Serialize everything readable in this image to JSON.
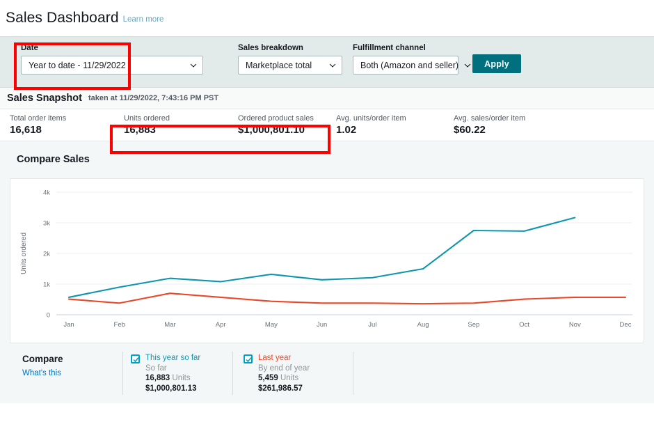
{
  "header": {
    "title": "Sales Dashboard",
    "learn_more": "Learn more"
  },
  "filters": {
    "date": {
      "label": "Date",
      "value": "Year to date - 11/29/2022"
    },
    "sales_breakdown": {
      "label": "Sales breakdown",
      "value": "Marketplace total"
    },
    "fulfillment_channel": {
      "label": "Fulfillment channel",
      "value": "Both (Amazon and seller)"
    },
    "apply_label": "Apply"
  },
  "snapshot": {
    "title": "Sales Snapshot",
    "taken_at": "taken at 11/29/2022, 7:43:16 PM PST",
    "metrics": [
      {
        "label": "Total order items",
        "value": "16,618"
      },
      {
        "label": "Units ordered",
        "value": "16,883"
      },
      {
        "label": "Ordered product sales",
        "value": "$1,000,801.10"
      },
      {
        "label": "Avg. units/order item",
        "value": "1.02"
      },
      {
        "label": "Avg. sales/order item",
        "value": "$60.22"
      }
    ]
  },
  "compare": {
    "heading": "Compare Sales",
    "compare_label": "Compare",
    "whats_this": "What's this",
    "series": [
      {
        "name": "This year so far",
        "period": "So far",
        "units_value": "16,883",
        "units_word": "Units",
        "amount": "$1,000,801.13",
        "color": "#0e96ae",
        "checked": true
      },
      {
        "name": "Last year",
        "period": "By end of year",
        "units_value": "5,459",
        "units_word": "Units",
        "amount": "$261,986.57",
        "color": "#e8492b",
        "checked": true
      }
    ]
  },
  "chart_data": {
    "type": "line",
    "title": "Compare Sales",
    "xlabel": "",
    "ylabel": "Units ordered",
    "categories": [
      "Jan",
      "Feb",
      "Mar",
      "Apr",
      "May",
      "Jun",
      "Jul",
      "Aug",
      "Sep",
      "Oct",
      "Nov",
      "Dec"
    ],
    "ylim": [
      0,
      4000
    ],
    "yticks": [
      0,
      1000,
      2000,
      3000,
      4000
    ],
    "ytick_labels": [
      "0",
      "1k",
      "2k",
      "3k",
      "4k"
    ],
    "grid": true,
    "legend_position": "bottom",
    "series": [
      {
        "name": "This year so far",
        "color": "#0e96ae",
        "values": [
          570,
          900,
          1190,
          1080,
          1320,
          1140,
          1210,
          1500,
          2750,
          2730,
          3170,
          null
        ]
      },
      {
        "name": "Last year",
        "color": "#e8492b",
        "values": [
          510,
          380,
          700,
          570,
          440,
          380,
          380,
          360,
          380,
          510,
          570,
          570
        ]
      }
    ]
  },
  "annotations": {
    "highlight_color": "#ff0000",
    "boxes": [
      "date-filter",
      "units-ordered-and-ordered-product-sales"
    ]
  }
}
